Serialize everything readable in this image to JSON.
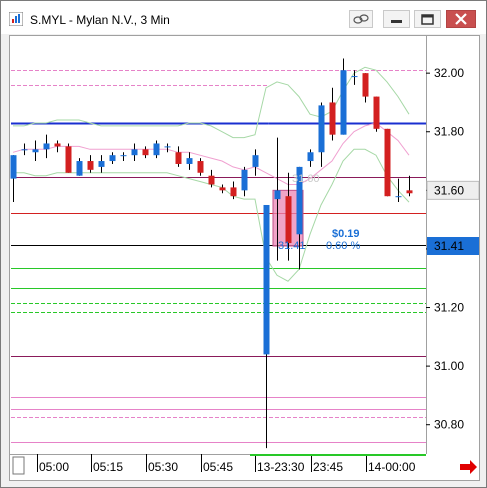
{
  "window": {
    "title": "S.MYL - Mylan N.V., 3 Min",
    "icons": [
      "link-icon",
      "minimize-icon",
      "maximize-icon",
      "close-icon"
    ]
  },
  "chart_data": {
    "type": "candlestick",
    "symbol": "S.MYL",
    "ylim": [
      30.7,
      32.12
    ],
    "y_ticks": [
      "32.00",
      "31.80",
      "31.60",
      "31.40",
      "31.20",
      "31.00",
      "30.80"
    ],
    "x_ticks": [
      "05:00",
      "05:15",
      "05:30",
      "05:45",
      "13-23:30",
      "23:45",
      "14-00:00"
    ],
    "last_price_label": "31.60",
    "cursor_price_label": "31.41",
    "annotations": {
      "change": "$0.19",
      "change_pct": "0.60 %",
      "from_price": "31.60",
      "to_price": "31.41"
    },
    "colors": {
      "up": "#1a6fd6",
      "down": "#d32020",
      "pink_box": "#e985b4",
      "last_price_box": "#eeeeee",
      "cursor_price_box": "#1a6fd6",
      "arrow": "#e00000"
    },
    "candles": [
      {
        "o": 31.64,
        "h": 31.72,
        "l": 31.56,
        "c": 31.72
      },
      {
        "o": 31.74,
        "h": 31.76,
        "l": 31.72,
        "c": 31.74
      },
      {
        "o": 31.73,
        "h": 31.77,
        "l": 31.7,
        "c": 31.74
      },
      {
        "o": 31.74,
        "h": 31.79,
        "l": 31.71,
        "c": 31.76
      },
      {
        "o": 31.76,
        "h": 31.77,
        "l": 31.73,
        "c": 31.75
      },
      {
        "o": 31.75,
        "h": 31.76,
        "l": 31.66,
        "c": 31.66
      },
      {
        "o": 31.65,
        "h": 31.71,
        "l": 31.65,
        "c": 31.7
      },
      {
        "o": 31.7,
        "h": 31.72,
        "l": 31.66,
        "c": 31.67
      },
      {
        "o": 31.68,
        "h": 31.72,
        "l": 31.66,
        "c": 31.7
      },
      {
        "o": 31.7,
        "h": 31.73,
        "l": 31.69,
        "c": 31.72
      },
      {
        "o": 31.72,
        "h": 31.73,
        "l": 31.7,
        "c": 31.72
      },
      {
        "o": 31.72,
        "h": 31.76,
        "l": 31.7,
        "c": 31.74
      },
      {
        "o": 31.74,
        "h": 31.75,
        "l": 31.71,
        "c": 31.72
      },
      {
        "o": 31.72,
        "h": 31.77,
        "l": 31.71,
        "c": 31.76
      },
      {
        "o": 31.75,
        "h": 31.76,
        "l": 31.73,
        "c": 31.75
      },
      {
        "o": 31.73,
        "h": 31.75,
        "l": 31.68,
        "c": 31.69
      },
      {
        "o": 31.69,
        "h": 31.73,
        "l": 31.67,
        "c": 31.71
      },
      {
        "o": 31.7,
        "h": 31.71,
        "l": 31.65,
        "c": 31.66
      },
      {
        "o": 31.65,
        "h": 31.67,
        "l": 31.61,
        "c": 31.62
      },
      {
        "o": 31.61,
        "h": 31.62,
        "l": 31.59,
        "c": 31.6
      },
      {
        "o": 31.61,
        "h": 31.63,
        "l": 31.57,
        "c": 31.58
      },
      {
        "o": 31.6,
        "h": 31.68,
        "l": 31.58,
        "c": 31.67
      },
      {
        "o": 31.68,
        "h": 31.74,
        "l": 31.65,
        "c": 31.72
      },
      {
        "o": 31.04,
        "h": 31.55,
        "l": 30.72,
        "c": 31.55
      },
      {
        "o": 31.57,
        "h": 31.78,
        "l": 31.36,
        "c": 31.6
      },
      {
        "o": 31.58,
        "h": 31.66,
        "l": 31.36,
        "c": 31.42
      },
      {
        "o": 31.45,
        "h": 31.68,
        "l": 31.33,
        "c": 31.68
      },
      {
        "o": 31.7,
        "h": 31.74,
        "l": 31.68,
        "c": 31.73
      },
      {
        "o": 31.73,
        "h": 31.9,
        "l": 31.68,
        "c": 31.89
      },
      {
        "o": 31.9,
        "h": 31.95,
        "l": 31.77,
        "c": 31.79
      },
      {
        "o": 31.79,
        "h": 32.05,
        "l": 31.79,
        "c": 32.01
      },
      {
        "o": 31.99,
        "h": 32.01,
        "l": 31.96,
        "c": 31.99
      },
      {
        "o": 32.0,
        "h": 32.0,
        "l": 31.9,
        "c": 31.92
      },
      {
        "o": 31.92,
        "h": 31.92,
        "l": 31.8,
        "c": 31.81
      },
      {
        "o": 31.81,
        "h": 31.81,
        "l": 31.58,
        "c": 31.58
      },
      {
        "o": 31.58,
        "h": 31.64,
        "l": 31.56,
        "c": 31.58
      },
      {
        "o": 31.6,
        "h": 31.65,
        "l": 31.58,
        "c": 31.59
      }
    ],
    "bands": {
      "upper": [
        31.82,
        31.82,
        31.83,
        31.83,
        31.84,
        31.84,
        31.84,
        31.83,
        31.82,
        31.82,
        31.82,
        31.82,
        31.82,
        31.82,
        31.82,
        31.82,
        31.83,
        31.83,
        31.82,
        31.8,
        31.78,
        31.78,
        31.79,
        31.95,
        31.97,
        31.96,
        31.92,
        31.86,
        31.85,
        31.87,
        31.94,
        32.0,
        32.02,
        32.01,
        31.97,
        31.92,
        31.86
      ],
      "lower": [
        31.66,
        31.66,
        31.65,
        31.65,
        31.66,
        31.66,
        31.66,
        31.66,
        31.66,
        31.66,
        31.66,
        31.66,
        31.66,
        31.66,
        31.66,
        31.65,
        31.64,
        31.63,
        31.62,
        31.61,
        31.58,
        31.57,
        31.57,
        31.37,
        31.31,
        31.29,
        31.33,
        31.45,
        31.55,
        31.62,
        31.7,
        31.74,
        31.74,
        31.72,
        31.65,
        31.6,
        31.56
      ],
      "middle": [
        31.73,
        31.74,
        31.74,
        31.74,
        31.75,
        31.75,
        31.75,
        31.74,
        31.74,
        31.74,
        31.74,
        31.74,
        31.74,
        31.74,
        31.74,
        31.73,
        31.73,
        31.72,
        31.71,
        31.7,
        31.68,
        31.67,
        31.68,
        31.66,
        31.64,
        31.62,
        31.62,
        31.64,
        31.67,
        31.7,
        31.76,
        31.8,
        31.82,
        31.83,
        31.8,
        31.77,
        31.72
      ]
    },
    "levels": [
      {
        "price": 32.01,
        "color": "#e682c8",
        "style": "dash",
        "segments": [
          [
            0,
            1
          ]
        ]
      },
      {
        "price": 31.96,
        "color": "#e682c8",
        "style": "dash",
        "segments": [
          [
            0,
            0.62
          ]
        ]
      },
      {
        "price": 31.83,
        "color": "#1a2fd0",
        "style": "solid",
        "width": 2,
        "segments": [
          [
            0,
            0.62
          ],
          [
            0.62,
            1
          ]
        ]
      },
      {
        "price": 31.645,
        "color": "#8a1a5a",
        "style": "solid",
        "segments": [
          [
            0,
            1
          ]
        ]
      },
      {
        "price": 31.5225,
        "color": "#d32020",
        "style": "solid",
        "segments": [
          [
            0,
            1
          ]
        ]
      },
      {
        "price": 31.415,
        "color": "#000000",
        "style": "solid",
        "segments": [
          [
            0,
            1
          ]
        ]
      },
      {
        "price": 31.335,
        "color": "#28c828",
        "style": "solid",
        "segments": [
          [
            0,
            1
          ]
        ]
      },
      {
        "price": 31.265,
        "color": "#28c828",
        "style": "solid",
        "segments": [
          [
            0,
            1
          ]
        ]
      },
      {
        "price": 31.215,
        "color": "#28c828",
        "style": "dash",
        "segments": [
          [
            0,
            1
          ]
        ]
      },
      {
        "price": 31.185,
        "color": "#28c828",
        "style": "dash",
        "segments": [
          [
            0,
            1
          ]
        ]
      },
      {
        "price": 31.035,
        "color": "#8a1a5a",
        "style": "solid",
        "segments": [
          [
            0,
            1
          ]
        ]
      },
      {
        "price": 30.895,
        "color": "#e682c8",
        "style": "solid",
        "segments": [
          [
            0,
            1
          ]
        ]
      },
      {
        "price": 30.855,
        "color": "#e682c8",
        "style": "solid",
        "segments": [
          [
            0,
            1
          ]
        ]
      },
      {
        "price": 30.825,
        "color": "#e682c8",
        "style": "dash",
        "segments": [
          [
            0,
            1
          ]
        ]
      },
      {
        "price": 30.74,
        "color": "#e682c8",
        "style": "solid",
        "segments": [
          [
            0,
            1
          ]
        ]
      }
    ],
    "zoom_box": {
      "from_index": 24,
      "to_index": 26,
      "from_price": 31.6,
      "to_price": 31.41
    }
  }
}
